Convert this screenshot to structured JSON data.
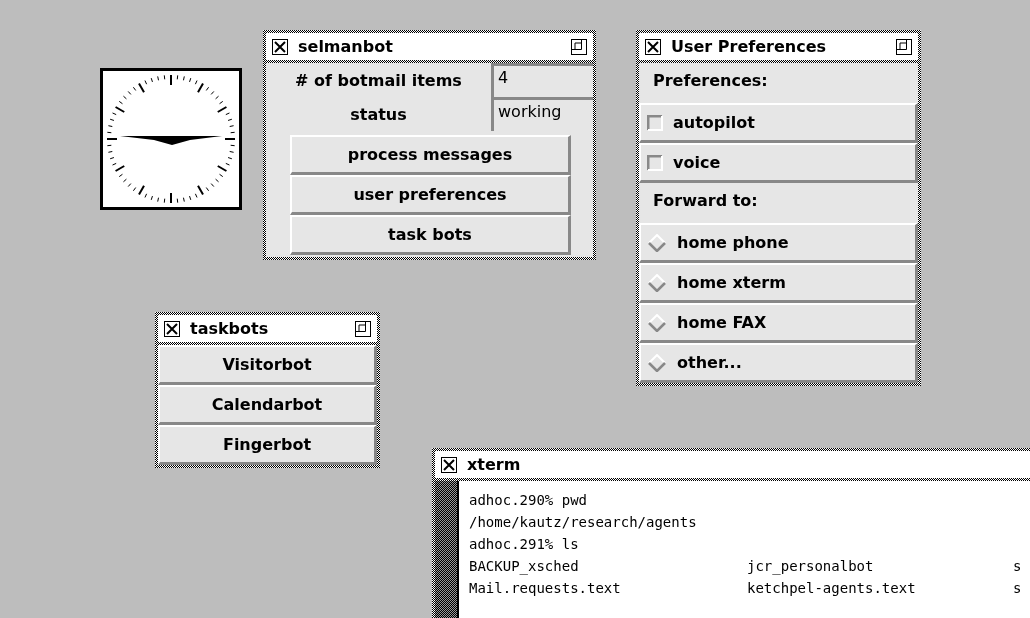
{
  "selmanbot": {
    "title": "selmanbot",
    "fields": [
      {
        "label": "# of botmail items",
        "value": "4"
      },
      {
        "label": "status",
        "value": "working"
      }
    ],
    "buttons": [
      "process messages",
      "user preferences",
      "task bots"
    ]
  },
  "user_preferences": {
    "title": "User Preferences",
    "items": [
      {
        "kind": "heading",
        "label": "Preferences:"
      },
      {
        "kind": "checkbox",
        "label": "autopilot",
        "checked": false
      },
      {
        "kind": "checkbox",
        "label": "voice",
        "checked": false
      },
      {
        "kind": "heading",
        "label": "Forward to:"
      },
      {
        "kind": "radio",
        "label": "home phone",
        "selected": false
      },
      {
        "kind": "radio",
        "label": "home xterm",
        "selected": false
      },
      {
        "kind": "radio",
        "label": "home FAX",
        "selected": false
      },
      {
        "kind": "radio",
        "label": "other...",
        "selected": false
      }
    ]
  },
  "taskbots": {
    "title": "taskbots",
    "buttons": [
      "Visitorbot",
      "Calendarbot",
      "Fingerbot"
    ]
  },
  "xterm": {
    "title": "xterm",
    "lines": [
      "adhoc.290% pwd",
      "/home/kautz/research/agents",
      "adhoc.291% ls"
    ],
    "listing": [
      [
        "BACKUP_xsched",
        "jcr_personalbot",
        "s"
      ],
      [
        "Mail.requests.text",
        "ketchpel-agents.text",
        "s"
      ]
    ]
  }
}
